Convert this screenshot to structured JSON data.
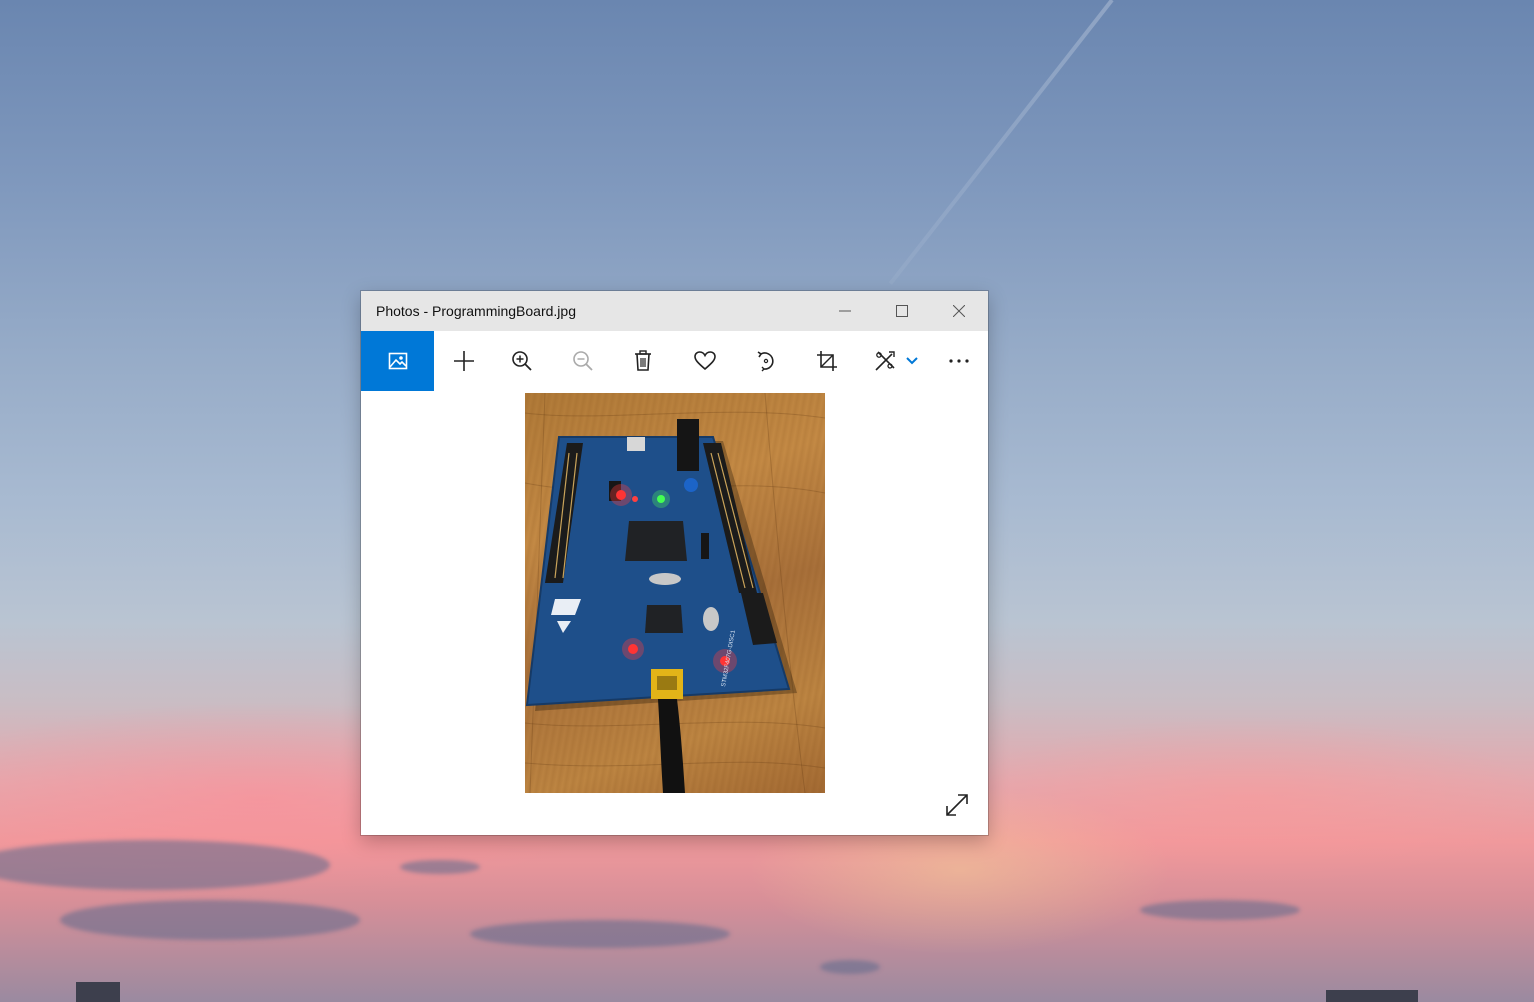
{
  "window": {
    "title": "Photos - ProgrammingBoard.jpg"
  },
  "title_bar": {
    "buttons": [
      {
        "name": "minimize",
        "icon": "minimize-icon"
      },
      {
        "name": "maximize",
        "icon": "maximize-icon"
      },
      {
        "name": "close",
        "icon": "close-icon"
      }
    ]
  },
  "toolbar": {
    "items": [
      {
        "name": "gallery",
        "icon": "photo-gallery-icon",
        "active": true
      },
      {
        "name": "add",
        "icon": "plus-icon"
      },
      {
        "name": "zoom-in",
        "icon": "zoom-in-icon"
      },
      {
        "name": "zoom-out",
        "icon": "zoom-out-icon",
        "disabled": true
      },
      {
        "name": "delete",
        "icon": "trash-icon"
      },
      {
        "name": "favorite",
        "icon": "heart-icon"
      },
      {
        "name": "rotate",
        "icon": "rotate-icon"
      },
      {
        "name": "crop",
        "icon": "crop-icon"
      },
      {
        "name": "edit-create",
        "icon": "edit-create-icon",
        "has_dropdown": true
      },
      {
        "name": "more",
        "icon": "more-icon"
      }
    ]
  },
  "viewer": {
    "image": "photo of a blue STM32F407G-DISC1 development board on a wooden table",
    "board_text": "STM32F407G-DISC1",
    "corner_action": {
      "icon": "fullscreen-icon"
    }
  },
  "colors": {
    "accent": "#0078d7",
    "title_bar": "#e6e6e6",
    "board_blue": "#1e4f8a"
  }
}
